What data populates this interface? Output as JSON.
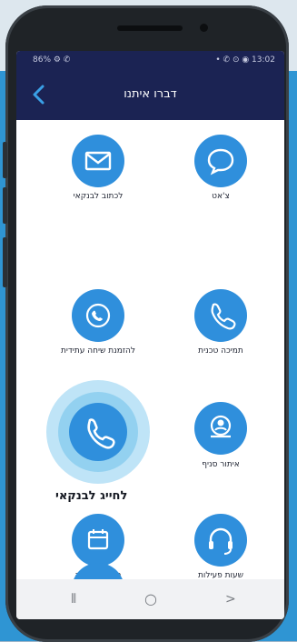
{
  "status_bar": {
    "left": "86% ⚙ ✆",
    "right": "• ✆ ⊙ ◉ 13:02"
  },
  "header": {
    "title": "דברו איתנו"
  },
  "actions": [
    {
      "label": "לכתוב לבנקאי",
      "icon": "envelope-icon"
    },
    {
      "label": "צ'אט",
      "icon": "chat-bubble-icon"
    },
    {
      "label": "להזמנת שיחה עתידית",
      "icon": "phone-clock-icon"
    },
    {
      "label": "תמיכה טכנית",
      "icon": "phone-handset-icon"
    },
    {
      "label": "לחייג לבנקאי",
      "icon": "phone-handset-icon"
    },
    {
      "label": "איתור סניף",
      "icon": "branch-locator-icon"
    },
    {
      "label": "הזמנת פגישה",
      "icon": "calendar-icon"
    },
    {
      "label": "שעות פעילות",
      "icon": "headset-icon"
    }
  ],
  "system_nav": {
    "recent": "⦀",
    "home": "○",
    "back": ">"
  },
  "colors": {
    "header": "#1b2353",
    "accent": "#2f8fdc",
    "halo": "#bfe4f7"
  }
}
